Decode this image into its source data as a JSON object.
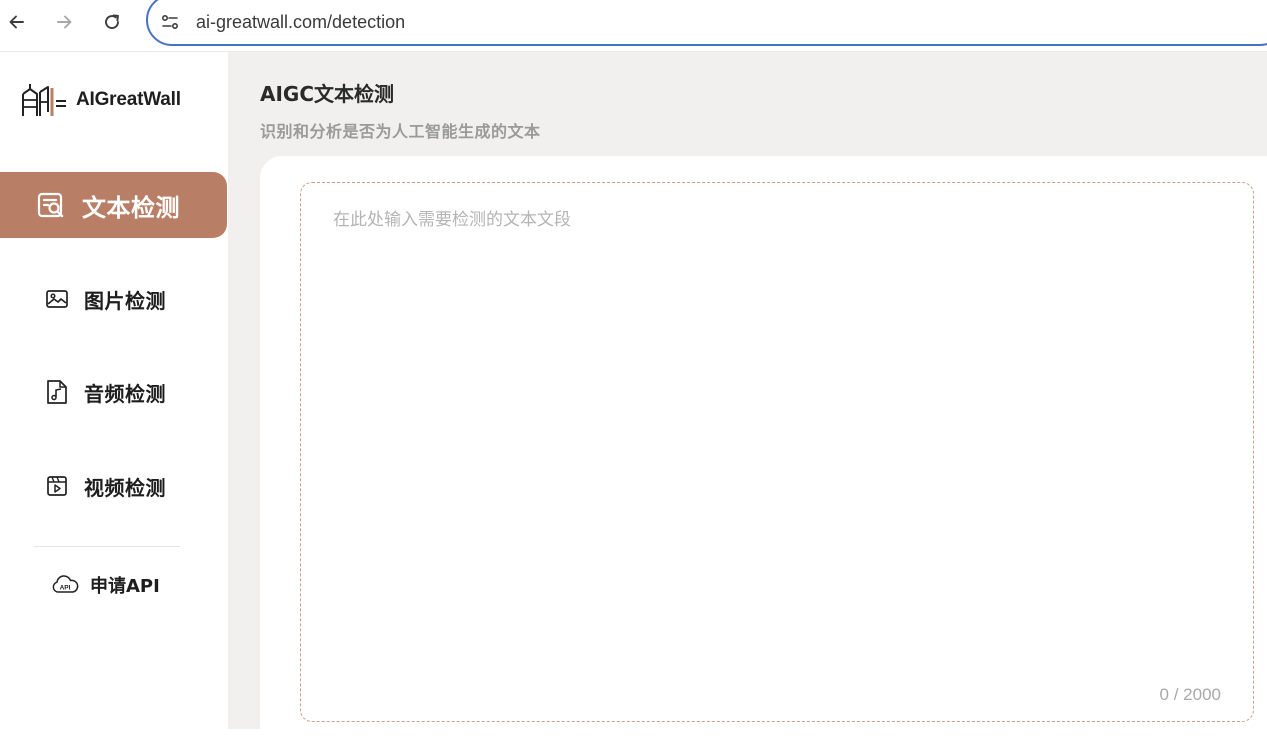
{
  "browser": {
    "url": "ai-greatwall.com/detection",
    "icons": [
      "back-arrow-icon",
      "forward-arrow-icon",
      "reload-icon",
      "site-settings-icon"
    ]
  },
  "sidebar": {
    "logo_text": "AIGreatWall",
    "items": [
      {
        "label": "文本检测",
        "icon": "text-search-icon",
        "active": true
      },
      {
        "label": "图片检测",
        "icon": "image-icon",
        "active": false
      },
      {
        "label": "音频检测",
        "icon": "audio-file-icon",
        "active": false
      },
      {
        "label": "视频检测",
        "icon": "video-icon",
        "active": false
      }
    ],
    "api": {
      "label": "申请API",
      "icon": "cloud-api-icon"
    }
  },
  "main": {
    "title": "AIGC文本检测",
    "subtitle": "识别和分析是否为人工智能生成的文本",
    "input": {
      "placeholder": "在此处输入需要检测的文本文段",
      "value": "",
      "counter": "0 / 2000"
    }
  },
  "colors": {
    "accent": "#b97e66",
    "url_outline": "#4a72c4",
    "main_bg": "#f1f0ee",
    "dashed_border": "#c8a08e"
  }
}
